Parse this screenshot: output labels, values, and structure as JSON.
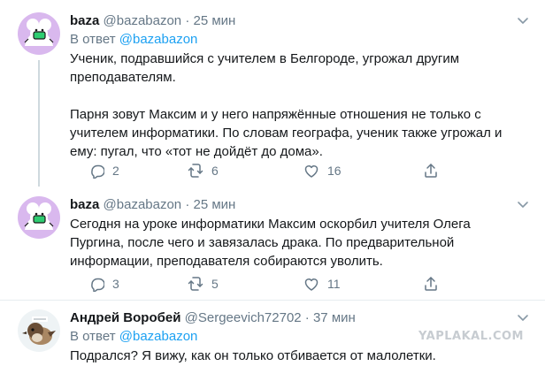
{
  "tweets": [
    {
      "name": "baza",
      "handle": "@bazabazon",
      "dot": "·",
      "time": "25 мин",
      "reply_prefix": "В ответ",
      "reply_handle": "@bazabazon",
      "text_1": "Ученик, подравшийся с учителем в Белгороде, угрожал другим\nпреподавателям.",
      "text_2": "Парня зовут Максим и у него напряжённые отношения не только с\nучителем информатики. По словам географа, ученик также угрожал и\nему: пугал, что «тот не дойдёт до дома».",
      "replies": "2",
      "retweets": "6",
      "likes": "16"
    },
    {
      "name": "baza",
      "handle": "@bazabazon",
      "dot": "·",
      "time": "25 мин",
      "text_1": "Сегодня на уроке информатики Максим оскорбил учителя Олега\nПургина, после чего и завязалась драка. По предварительной\nинформации, преподавателя собираются уволить.",
      "replies": "3",
      "retweets": "5",
      "likes": "11"
    },
    {
      "name": "Андрей Воробей",
      "handle": "@Sergeevich72702",
      "dot": "·",
      "time": "37 мин",
      "reply_prefix": "В ответ",
      "reply_handle": "@bazabazon",
      "text_1": "Подрался? Я вижу, как он только отбивается от малолетки."
    }
  ],
  "icons": {
    "reply": "reply-icon",
    "retweet": "retweet-icon",
    "like": "heart-icon",
    "share": "share-icon",
    "menu": "chevron-down-icon"
  },
  "colors": {
    "link": "#1da1f2",
    "muted": "#657786",
    "text": "#14171a",
    "avatar_bg": "#d9b8ee"
  },
  "watermark": "YAPLAKAL.COM"
}
